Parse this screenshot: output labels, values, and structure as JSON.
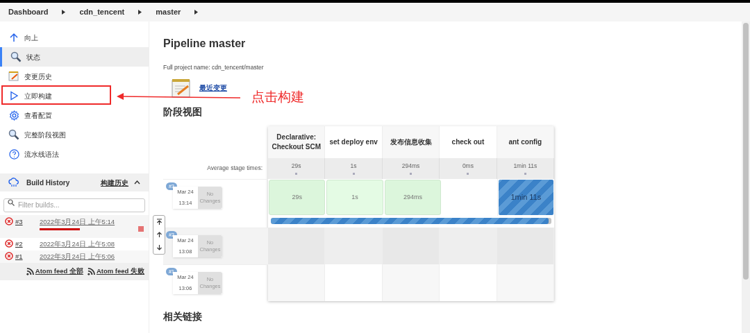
{
  "breadcrumb": [
    "Dashboard",
    "cdn_tencent",
    "master"
  ],
  "sidebar": {
    "items": [
      {
        "label": "向上",
        "kind": "up",
        "selected": false,
        "annotated": false
      },
      {
        "label": "状态",
        "kind": "search",
        "selected": true,
        "annotated": false
      },
      {
        "label": "变更历史",
        "kind": "notepad",
        "selected": false,
        "annotated": false
      },
      {
        "label": "立即构建",
        "kind": "play",
        "selected": false,
        "annotated": true
      },
      {
        "label": "查看配置",
        "kind": "gear",
        "selected": false,
        "annotated": false
      },
      {
        "label": "完整阶段视图",
        "kind": "search",
        "selected": false,
        "annotated": false
      },
      {
        "label": "流水线语法",
        "kind": "help",
        "selected": false,
        "annotated": false
      }
    ]
  },
  "build_history": {
    "title": "Build History",
    "link": "构建历史",
    "expanded": true,
    "filter_placeholder": "Filter builds...",
    "builds": [
      {
        "number": "#3",
        "date": "2022年3月24日 上午5:14",
        "kind": "failed",
        "running": true
      },
      {
        "number": "#2",
        "date": "2022年3月24日 上午5:08",
        "kind": "failed",
        "running": false
      },
      {
        "number": "#1",
        "date": "2022年3月24日 上午5:06",
        "kind": "failed",
        "running": false
      }
    ],
    "feeds": [
      "Atom feed 全部",
      "Atom feed 失败"
    ]
  },
  "main": {
    "title": "Pipeline master",
    "full_name": "Full project name: cdn_tencent/master",
    "recent_changes": "最近变更",
    "stage_view_heading": "阶段视图",
    "related_heading": "相关链接"
  },
  "annotation": "点击构建",
  "stage_view": {
    "average_label": "Average stage times:",
    "stages": [
      {
        "name": "Declarative: Checkout SCM",
        "average": "29s"
      },
      {
        "name": "set deploy env",
        "average": "1s"
      },
      {
        "name": "发布信息收集",
        "average": "294ms"
      },
      {
        "name": "check out",
        "average": "0ms"
      },
      {
        "name": "ant config",
        "average": "1min 11s"
      }
    ],
    "runs": [
      {
        "badge": "#3",
        "date": "Mar 24",
        "time": "13:14",
        "changes": "No Changes",
        "level": 0.99,
        "cells": [
          {
            "kind": "success",
            "text": "29s"
          },
          {
            "kind": "success",
            "text": "1s"
          },
          {
            "kind": "success",
            "text": "294ms"
          },
          {
            "kind": "empty"
          },
          {
            "kind": "running",
            "text": "1min 11s"
          }
        ]
      },
      {
        "badge": "#2",
        "date": "Mar 24",
        "time": "13:08",
        "changes": "No Changes",
        "cells": [
          {
            "kind": "empty"
          },
          {
            "kind": "empty"
          },
          {
            "kind": "empty"
          },
          {
            "kind": "empty"
          },
          {
            "kind": "empty"
          }
        ]
      },
      {
        "badge": "#1",
        "date": "Mar 24",
        "time": "13:06",
        "changes": "No Changes",
        "cells": [
          {
            "kind": "empty"
          },
          {
            "kind": "empty"
          },
          {
            "kind": "empty"
          },
          {
            "kind": "empty"
          },
          {
            "kind": "empty"
          }
        ]
      }
    ]
  }
}
